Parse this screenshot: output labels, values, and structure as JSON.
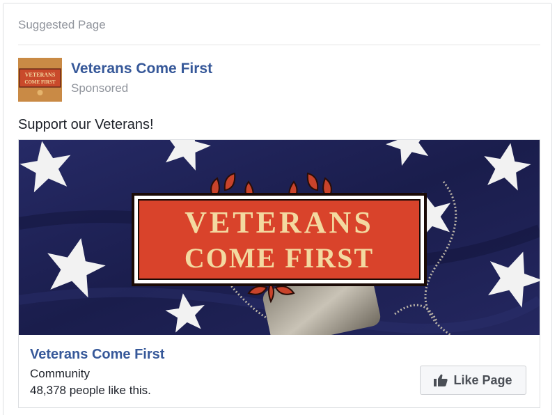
{
  "card": {
    "header_label": "Suggested Page",
    "page_name": "Veterans Come First",
    "sponsored_label": "Sponsored",
    "post_text": "Support our Veterans!"
  },
  "ad_image": {
    "banner_line1": "VETERANS",
    "banner_line2": "COME FIRST",
    "avatar_text": "VETERANS COME FIRST"
  },
  "footer": {
    "page_name": "Veterans Come First",
    "category": "Community",
    "likes_text": "48,378 people like this.",
    "like_button_label": "Like Page",
    "like_icon": "thumbs-up-icon"
  },
  "colors": {
    "link_blue": "#365899",
    "meta_gray": "#90949c",
    "banner_red": "#d9432b",
    "banner_gold": "#f3d9a0",
    "flag_navy": "#1c1f52"
  }
}
